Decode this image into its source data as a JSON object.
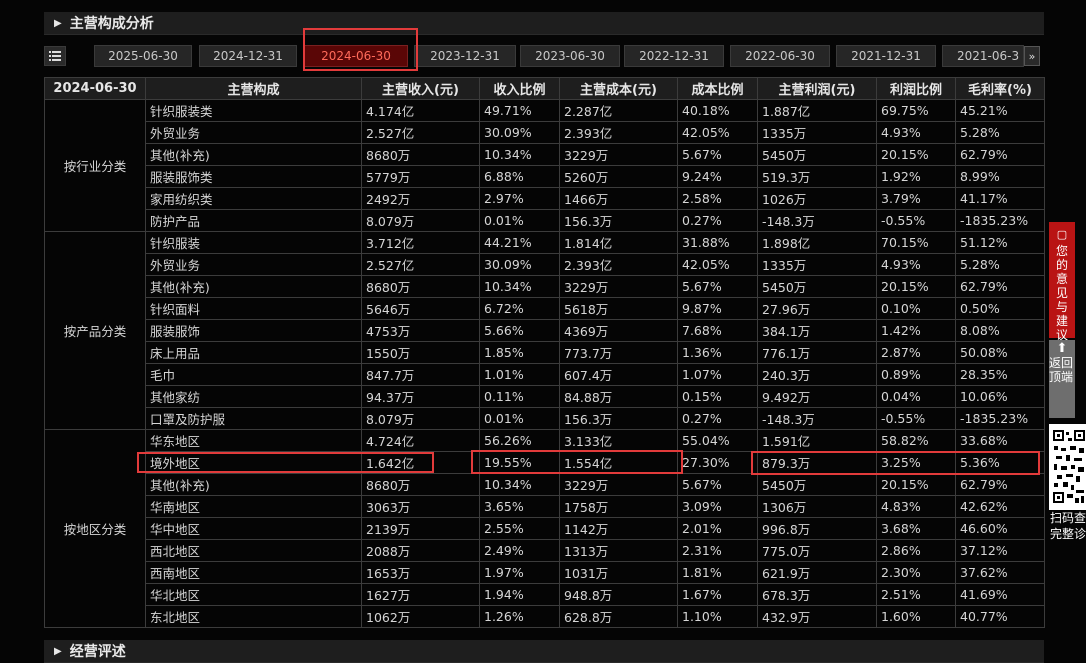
{
  "section": {
    "title": "主营构成分析",
    "next_title": "经营评述"
  },
  "toolbar": {
    "list_icon": "list-icon"
  },
  "tabs": [
    {
      "label": "2025-06-30",
      "active": false
    },
    {
      "label": "2024-12-31",
      "active": false
    },
    {
      "label": "2024-06-30",
      "active": true
    },
    {
      "label": "2023-12-31",
      "active": false
    },
    {
      "label": "2023-06-30",
      "active": false
    },
    {
      "label": "2022-12-31",
      "active": false
    },
    {
      "label": "2022-06-30",
      "active": false
    },
    {
      "label": "2021-12-31",
      "active": false
    },
    {
      "label": "2021-06-3",
      "active": false
    }
  ],
  "next_icon": "double-chevron-right-icon",
  "table": {
    "headers": [
      "2024-06-30",
      "主营构成",
      "主营收入(元)",
      "收入比例",
      "主营成本(元)",
      "成本比例",
      "主营利润(元)",
      "利润比例",
      "毛利率(%)"
    ],
    "groups": [
      {
        "category": "按行业分类",
        "rows": [
          [
            "针织服装类",
            "4.174亿",
            "49.71%",
            "2.287亿",
            "40.18%",
            "1.887亿",
            "69.75%",
            "45.21%"
          ],
          [
            "外贸业务",
            "2.527亿",
            "30.09%",
            "2.393亿",
            "42.05%",
            "1335万",
            "4.93%",
            "5.28%"
          ],
          [
            "其他(补充)",
            "8680万",
            "10.34%",
            "3229万",
            "5.67%",
            "5450万",
            "20.15%",
            "62.79%"
          ],
          [
            "服装服饰类",
            "5779万",
            "6.88%",
            "5260万",
            "9.24%",
            "519.3万",
            "1.92%",
            "8.99%"
          ],
          [
            "家用纺织类",
            "2492万",
            "2.97%",
            "1466万",
            "2.58%",
            "1026万",
            "3.79%",
            "41.17%"
          ],
          [
            "防护产品",
            "8.079万",
            "0.01%",
            "156.3万",
            "0.27%",
            "-148.3万",
            "-0.55%",
            "-1835.23%"
          ]
        ]
      },
      {
        "category": "按产品分类",
        "rows": [
          [
            "针织服装",
            "3.712亿",
            "44.21%",
            "1.814亿",
            "31.88%",
            "1.898亿",
            "70.15%",
            "51.12%"
          ],
          [
            "外贸业务",
            "2.527亿",
            "30.09%",
            "2.393亿",
            "42.05%",
            "1335万",
            "4.93%",
            "5.28%"
          ],
          [
            "其他(补充)",
            "8680万",
            "10.34%",
            "3229万",
            "5.67%",
            "5450万",
            "20.15%",
            "62.79%"
          ],
          [
            "针织面料",
            "5646万",
            "6.72%",
            "5618万",
            "9.87%",
            "27.96万",
            "0.10%",
            "0.50%"
          ],
          [
            "服装服饰",
            "4753万",
            "5.66%",
            "4369万",
            "7.68%",
            "384.1万",
            "1.42%",
            "8.08%"
          ],
          [
            "床上用品",
            "1550万",
            "1.85%",
            "773.7万",
            "1.36%",
            "776.1万",
            "2.87%",
            "50.08%"
          ],
          [
            "毛巾",
            "847.7万",
            "1.01%",
            "607.4万",
            "1.07%",
            "240.3万",
            "0.89%",
            "28.35%"
          ],
          [
            "其他家纺",
            "94.37万",
            "0.11%",
            "84.88万",
            "0.15%",
            "9.492万",
            "0.04%",
            "10.06%"
          ],
          [
            "口罩及防护服",
            "8.079万",
            "0.01%",
            "156.3万",
            "0.27%",
            "-148.3万",
            "-0.55%",
            "-1835.23%"
          ]
        ]
      },
      {
        "category": "按地区分类",
        "rows": [
          [
            "华东地区",
            "4.724亿",
            "56.26%",
            "3.133亿",
            "55.04%",
            "1.591亿",
            "58.82%",
            "33.68%"
          ],
          [
            "境外地区",
            "1.642亿",
            "19.55%",
            "1.554亿",
            "27.30%",
            "879.3万",
            "3.25%",
            "5.36%"
          ],
          [
            "其他(补充)",
            "8680万",
            "10.34%",
            "3229万",
            "5.67%",
            "5450万",
            "20.15%",
            "62.79%"
          ],
          [
            "华南地区",
            "3063万",
            "3.65%",
            "1758万",
            "3.09%",
            "1306万",
            "4.83%",
            "42.62%"
          ],
          [
            "华中地区",
            "2139万",
            "2.55%",
            "1142万",
            "2.01%",
            "996.8万",
            "3.68%",
            "46.60%"
          ],
          [
            "西北地区",
            "2088万",
            "2.49%",
            "1313万",
            "2.31%",
            "775.0万",
            "2.86%",
            "37.12%"
          ],
          [
            "西南地区",
            "1653万",
            "1.97%",
            "1031万",
            "1.81%",
            "621.9万",
            "2.30%",
            "37.62%"
          ],
          [
            "华北地区",
            "1627万",
            "1.94%",
            "948.8万",
            "1.67%",
            "678.3万",
            "2.51%",
            "41.69%"
          ],
          [
            "东北地区",
            "1062万",
            "1.26%",
            "628.8万",
            "1.10%",
            "432.9万",
            "1.60%",
            "40.77%"
          ]
        ]
      }
    ]
  },
  "side": {
    "feedback": "您的意见与建议",
    "back_top": "返回顶端",
    "qr_text": "扫码查完整诊"
  },
  "colors": {
    "highlight": "#e23b3b",
    "active_tab": "#5a0606",
    "feedback_bg": "#b91414"
  }
}
